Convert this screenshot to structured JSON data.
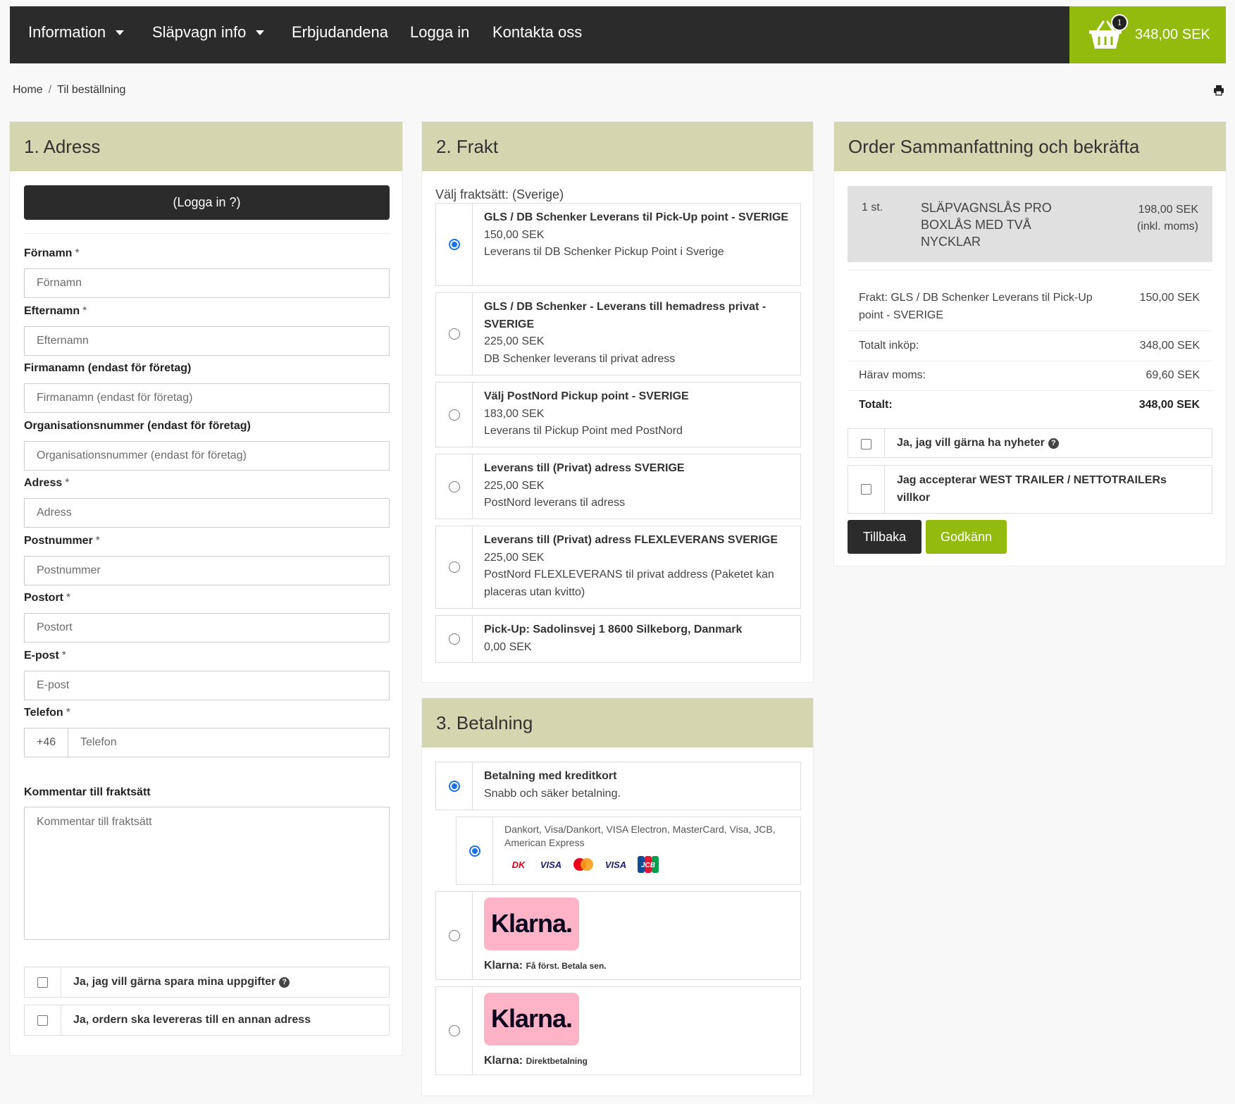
{
  "nav": {
    "items": [
      {
        "label": "Information",
        "dropdown": true
      },
      {
        "label": "Släpvagn info",
        "dropdown": true
      },
      {
        "label": "Erbjudandena",
        "dropdown": false
      },
      {
        "label": "Logga in",
        "dropdown": false
      },
      {
        "label": "Kontakta oss",
        "dropdown": false
      }
    ],
    "cart_count": "1",
    "cart_total": "348,00 SEK"
  },
  "breadcrumb": {
    "home": "Home",
    "sep": "/",
    "current": "Til beställning"
  },
  "address": {
    "title": "1. Adress",
    "login_label": "(Logga in ?)",
    "required_mark": "*",
    "fields": {
      "fornamn": {
        "label": "Förnamn",
        "placeholder": "Förnamn"
      },
      "efternamn": {
        "label": "Efternamn",
        "placeholder": "Efternamn"
      },
      "firmanamn": {
        "label": "Firmanamn (endast för företag)",
        "placeholder": "Firmanamn (endast för företag)"
      },
      "orgnr": {
        "label": "Organisationsnummer (endast för företag)",
        "placeholder": "Organisationsnummer (endast för företag)"
      },
      "adress": {
        "label": "Adress",
        "placeholder": "Adress"
      },
      "postnummer": {
        "label": "Postnummer",
        "placeholder": "Postnummer"
      },
      "postort": {
        "label": "Postort",
        "placeholder": "Postort"
      },
      "epost": {
        "label": "E-post",
        "placeholder": "E-post"
      },
      "telefon": {
        "label": "Telefon",
        "placeholder": "Telefon",
        "prefix": "+46"
      }
    },
    "comment": {
      "label": "Kommentar till fraktsätt",
      "placeholder": "Kommentar till fraktsätt"
    },
    "save_label": "Ja, jag vill gärna spara mina uppgifter",
    "other_address_label": "Ja, ordern ska levereras till en annan adress"
  },
  "shipping": {
    "title": "2. Frakt",
    "choose_label": "Välj fraktsätt: (Sverige)",
    "options": [
      {
        "title": "GLS / DB Schenker Leverans til Pick-Up point - SVERIGE",
        "price": "150,00 SEK",
        "desc": "Leverans til DB Schenker Pickup Point i Sverige",
        "selected": true
      },
      {
        "title": "GLS / DB Schenker - Leverans till hemadress privat - SVERIGE",
        "price": "225,00 SEK",
        "desc": "DB Schenker leverans til privat adress",
        "selected": false
      },
      {
        "title": "Välj PostNord Pickup point - SVERIGE",
        "price": "183,00 SEK",
        "desc": "Leverans til Pickup Point med PostNord",
        "selected": false
      },
      {
        "title": "Leverans till (Privat) adress SVERIGE",
        "price": "225,00 SEK",
        "desc": "PostNord leverans til adress",
        "selected": false
      },
      {
        "title": "Leverans till (Privat) adress FLEXLEVERANS SVERIGE",
        "price": "225,00 SEK",
        "desc": "PostNord FLEXLEVERANS til privat address (Paketet kan placeras utan kvitto)",
        "selected": false
      },
      {
        "title": "Pick-Up: Sadolinsvej 1 8600 Silkeborg, Danmark",
        "price": "0,00 SEK",
        "desc": "",
        "selected": false
      }
    ]
  },
  "payment": {
    "title": "3. Betalning",
    "card": {
      "title": "Betalning med kreditkort",
      "desc": "Snabb och säker betalning."
    },
    "card_types": "Dankort, Visa/Dankort, VISA Electron, MasterCard, Visa, JCB, American Express",
    "card_logos": [
      "DK",
      "VISA",
      "MC",
      "VISA",
      "JCB"
    ],
    "klarna_logo": "Klarna.",
    "klarna1": {
      "label": "Klarna:",
      "desc": "Få först. Betala sen."
    },
    "klarna2": {
      "label": "Klarna:",
      "desc": "Direktbetalning"
    }
  },
  "summary": {
    "title": "Order Sammanfattning och bekräfta",
    "item": {
      "qty": "1 st.",
      "name": "SLÄPVAGNSLÅS PRO BOXLÅS MED TVÅ NYCKLAR",
      "price": "198,00 SEK",
      "price_note": "(inkl. moms)"
    },
    "shipping_label": "Frakt: GLS / DB Schenker Leverans til Pick-Up point - SVERIGE",
    "shipping_price": "150,00 SEK",
    "subtotal_label": "Totalt inköp:",
    "subtotal": "348,00 SEK",
    "vat_label": "Härav moms:",
    "vat": "69,60 SEK",
    "total_label": "Totalt:",
    "total": "348,00 SEK",
    "newsletter_label": "Ja, jag vill gärna ha nyheter",
    "terms_label": "Jag accepterar WEST TRAILER / NETTOTRAILERs villkor",
    "back_label": "Tillbaka",
    "confirm_label": "Godkänn"
  },
  "colors": {
    "nav_bg": "#2b2b2b",
    "accent": "#93bb0d",
    "panel_head": "#d3d6ae",
    "radio": "#1a73e8",
    "klarna": "#ffb3c7"
  }
}
